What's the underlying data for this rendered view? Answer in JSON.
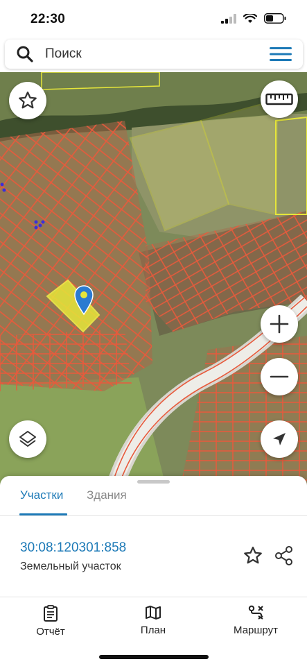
{
  "status_bar": {
    "time": "22:30"
  },
  "search": {
    "placeholder": "Поиск"
  },
  "sheet": {
    "tabs": [
      {
        "label": "Участки",
        "active": true
      },
      {
        "label": "Здания",
        "active": false
      }
    ],
    "parcel": {
      "cadastral_number": "30:08:120301:858",
      "type": "Земельный участок"
    }
  },
  "bottom_nav": [
    {
      "label": "Отчёт",
      "icon": "report-icon"
    },
    {
      "label": "План",
      "icon": "map-plan-icon"
    },
    {
      "label": "Маршрут",
      "icon": "route-icon"
    }
  ],
  "colors": {
    "accent": "#1d7ab7",
    "parcel_border": "#e85a3c",
    "highlight_parcel": "#e6e63a",
    "pin": "#2b7bd1"
  }
}
